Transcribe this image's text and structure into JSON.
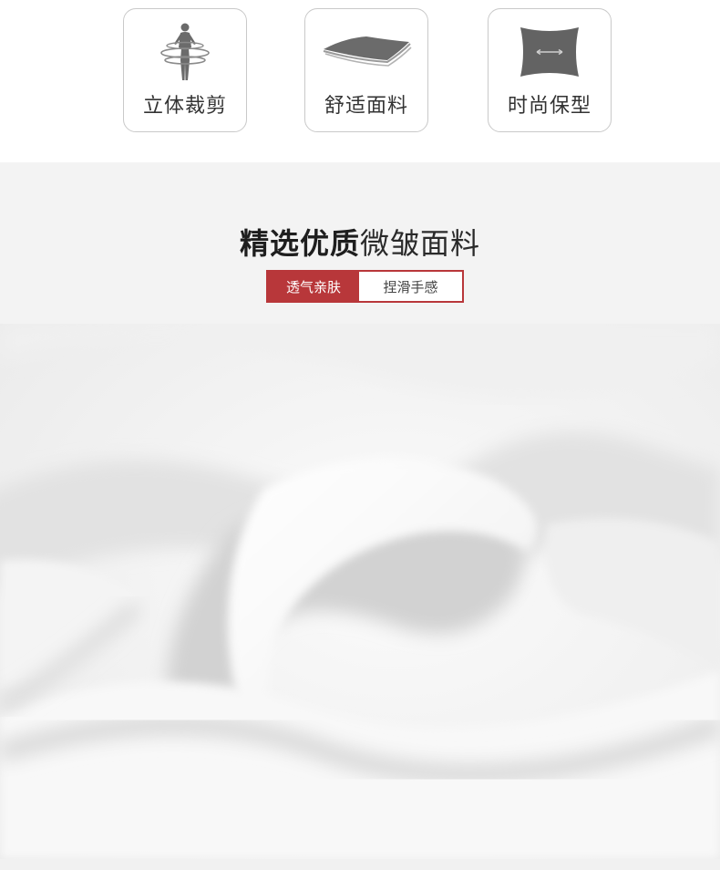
{
  "features": [
    {
      "label": "立体裁剪",
      "icon": "body-silhouette-icon"
    },
    {
      "label": "舒适面料",
      "icon": "fabric-sheet-icon"
    },
    {
      "label": "时尚保型",
      "icon": "stretch-square-icon"
    }
  ],
  "section": {
    "title_strong": "精选优质",
    "title_light": "微皱面料",
    "tags": [
      "透气亲肤",
      "捏滑手感"
    ]
  },
  "colors": {
    "accent": "#b8373a",
    "band": "#f3f3f3",
    "card_border": "#c9c9c9",
    "icon_gray": "#6b6b6b"
  }
}
